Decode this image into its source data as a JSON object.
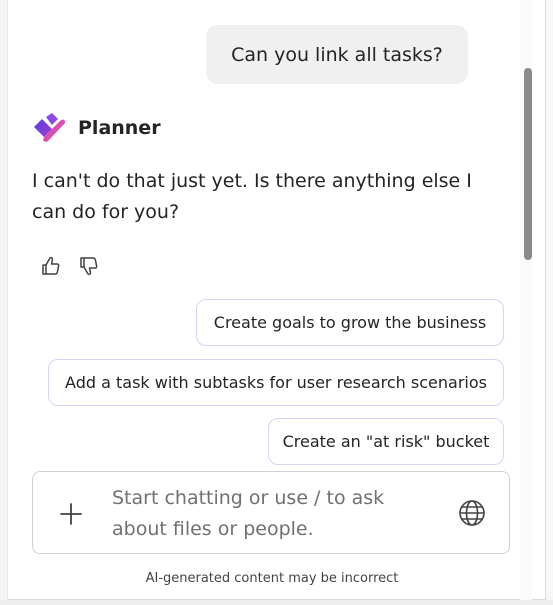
{
  "user_message": "Can you link all tasks?",
  "bot": {
    "name": "Planner",
    "logo_icon": "planner-logo-icon",
    "message": "I can't do that just yet. Is there anything else I can do for you?"
  },
  "feedback": {
    "thumbs_up_icon": "thumbs-up-icon",
    "thumbs_down_icon": "thumbs-down-icon"
  },
  "suggestions": [
    "Create goals to grow the business",
    "Add a task with subtasks for user research scenarios",
    "Create an \"at risk\" bucket"
  ],
  "composer": {
    "placeholder": "Start chatting or use / to ask about files or people.",
    "add_icon": "plus-icon",
    "globe_icon": "globe-icon"
  },
  "disclaimer": "AI-generated content may be incorrect",
  "colors": {
    "chip_border": "#d8d3f6",
    "user_bubble": "#f0f0f0",
    "logo_purple": "#7b3fe4",
    "logo_pink": "#e8467c"
  }
}
